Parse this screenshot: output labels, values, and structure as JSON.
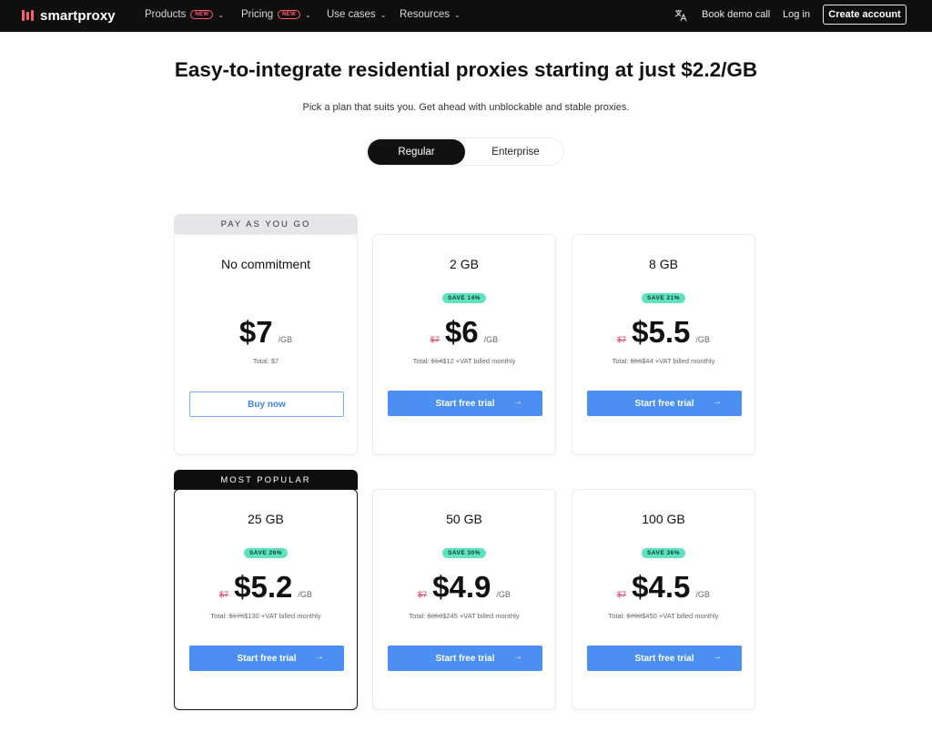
{
  "nav": {
    "brand": "smartproxy",
    "logo_colors": [
      "#ff5d6c",
      "#ff5d6c",
      "#ff5d6c"
    ],
    "links": [
      {
        "label": "Products",
        "badge": "NEW"
      },
      {
        "label": "Pricing",
        "badge": "NEW"
      },
      {
        "label": "Use cases",
        "badge": ""
      },
      {
        "label": "Resources",
        "badge": ""
      }
    ],
    "book_demo": "Book demo call",
    "login": "Log in",
    "create_account": "Create account"
  },
  "hero": {
    "title": "Easy-to-integrate residential proxies starting at just $2.2/GB",
    "subtitle": "Pick a plan that suits you. Get ahead with unblockable and stable proxies."
  },
  "toggle": {
    "regular": "Regular",
    "enterprise": "Enterprise"
  },
  "plans": [
    {
      "ribbon": "PAY AS YOU GO",
      "title": "No commitment",
      "save": "",
      "old": "",
      "price": "$7",
      "per": "/GB",
      "total": "Total: $7",
      "total_old": "",
      "total_new": "",
      "total_suffix": "",
      "cta": "Buy now"
    },
    {
      "ribbon": "",
      "title": "2 GB",
      "save": "SAVE 14%",
      "old": "$7",
      "price": "$6",
      "per": "/GB",
      "total_prefix": "Total: ",
      "total_old": "$14",
      "total_new": "$12",
      "total_suffix": " +VAT billed monthly",
      "cta": "Start free trial"
    },
    {
      "ribbon": "",
      "title": "8 GB",
      "save": "SAVE 21%",
      "old": "$7",
      "price": "$5.5",
      "per": "/GB",
      "total_prefix": "Total: ",
      "total_old": "$56",
      "total_new": "$44",
      "total_suffix": " +VAT billed monthly",
      "cta": "Start free trial"
    },
    {
      "ribbon": "MOST POPULAR",
      "title": "25 GB",
      "save": "SAVE 26%",
      "old": "$7",
      "price": "$5.2",
      "per": "/GB",
      "total_prefix": "Total: ",
      "total_old": "$175",
      "total_new": "$130",
      "total_suffix": " +VAT billed monthly",
      "cta": "Start free trial"
    },
    {
      "ribbon": "",
      "title": "50 GB",
      "save": "SAVE 30%",
      "old": "$7",
      "price": "$4.9",
      "per": "/GB",
      "total_prefix": "Total: ",
      "total_old": "$350",
      "total_new": "$245",
      "total_suffix": " +VAT billed monthly",
      "cta": "Start free trial"
    },
    {
      "ribbon": "",
      "title": "100 GB",
      "save": "SAVE 36%",
      "old": "$7",
      "price": "$4.5",
      "per": "/GB",
      "total_prefix": "Total: ",
      "total_old": "$700",
      "total_new": "$450",
      "total_suffix": " +VAT billed monthly",
      "cta": "Start free trial"
    }
  ],
  "colors": {
    "accent_blue": "#4a8ff1",
    "save_green": "#5ee2bf",
    "old_price_red": "#e2435a",
    "nav_bg": "#0f0f10"
  },
  "icons": {
    "translate": "translate-icon",
    "chevron": "chevron-down-icon",
    "arrow": "arrow-right-icon"
  }
}
